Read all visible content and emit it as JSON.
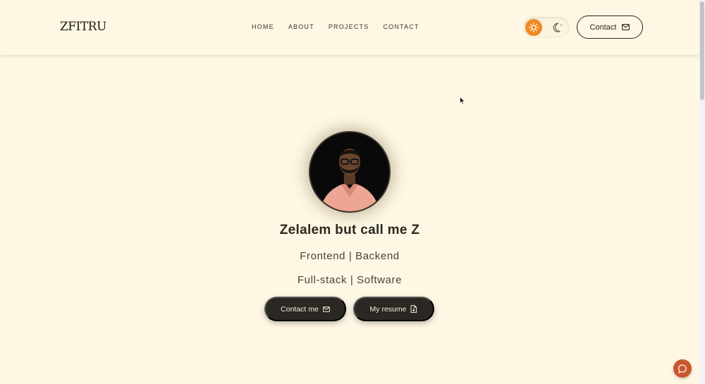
{
  "header": {
    "logo_text": "ZFITRU",
    "nav": [
      {
        "label": "HOME"
      },
      {
        "label": "ABOUT"
      },
      {
        "label": "PROJECTS"
      },
      {
        "label": "CONTACT"
      }
    ],
    "contact_button": "Contact",
    "theme": {
      "active": "light",
      "sun_icon": "sun-icon",
      "moon_icon": "moon-icon"
    }
  },
  "hero": {
    "name": "Zelalem but call me Z",
    "line1": "Frontend | Backend",
    "line2": "Full-stack | Software",
    "contact_me_button": "Contact me",
    "resume_button": "My resume"
  },
  "colors": {
    "background": "#fdf7e3",
    "accent_orange": "#f08a24",
    "dark_button": "#2b2722",
    "chat_fab": "#c9562c"
  }
}
